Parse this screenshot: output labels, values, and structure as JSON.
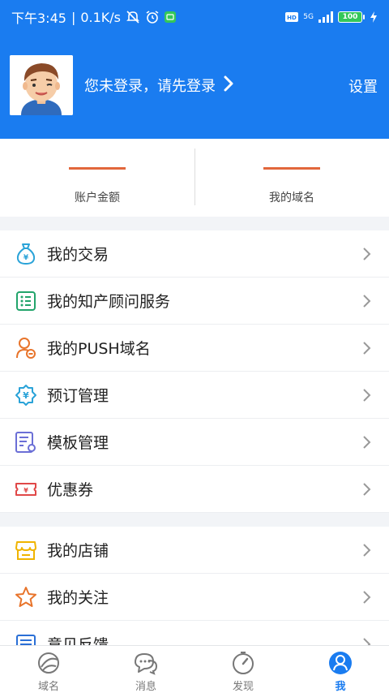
{
  "status_bar": {
    "time": "下午3:45",
    "speed": "0.1K/s",
    "network": "5G",
    "hd": "HD",
    "battery": "100"
  },
  "profile": {
    "login_prompt": "您未登录，请先登录",
    "settings_label": "设置"
  },
  "stats": [
    {
      "label": "账户金额"
    },
    {
      "label": "我的域名"
    }
  ],
  "menu_group1": [
    {
      "label": "我的交易",
      "icon": "money-bag-icon"
    },
    {
      "label": "我的知产顾问服务",
      "icon": "list-icon"
    },
    {
      "label": "我的PUSH域名",
      "icon": "user-push-icon"
    },
    {
      "label": "预订管理",
      "icon": "yen-gear-icon"
    },
    {
      "label": "模板管理",
      "icon": "template-icon"
    },
    {
      "label": "优惠券",
      "icon": "coupon-icon"
    }
  ],
  "menu_group2": [
    {
      "label": "我的店铺",
      "icon": "store-icon"
    },
    {
      "label": "我的关注",
      "icon": "star-icon"
    },
    {
      "label": "意见反馈",
      "icon": "feedback-icon"
    }
  ],
  "tabbar": [
    {
      "label": "域名",
      "icon": "domain-tab-icon"
    },
    {
      "label": "消息",
      "icon": "message-tab-icon"
    },
    {
      "label": "发现",
      "icon": "discover-tab-icon"
    },
    {
      "label": "我",
      "icon": "me-tab-icon"
    }
  ],
  "colors": {
    "brand": "#1a7cf0",
    "accent_bar": "#e2673c",
    "battery": "#34c759"
  }
}
